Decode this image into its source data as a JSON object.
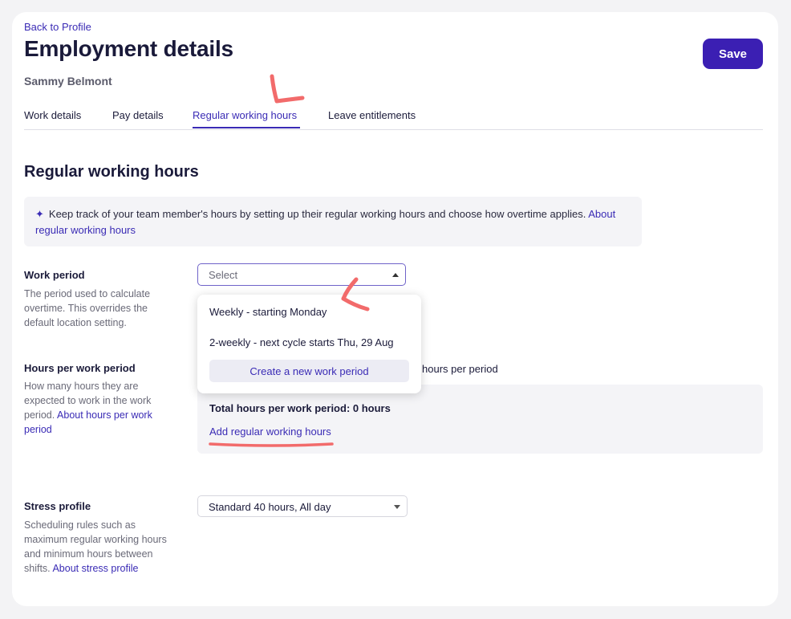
{
  "header": {
    "back_link": "Back to Profile",
    "title": "Employment details",
    "employee_name": "Sammy Belmont",
    "save_label": "Save"
  },
  "tabs": [
    {
      "label": "Work details"
    },
    {
      "label": "Pay details"
    },
    {
      "label": "Regular working hours",
      "active": true
    },
    {
      "label": "Leave entitlements"
    }
  ],
  "section": {
    "title": "Regular working hours",
    "info_text": "Keep track of your team member's hours by setting up their regular working hours and choose how overtime applies.",
    "info_link": "About regular working hours",
    "info_icon": "sparkle-icon"
  },
  "work_period": {
    "label": "Work period",
    "help": "The period used to calculate overtime. This overrides the default location setting.",
    "placeholder": "Select",
    "options": [
      "Weekly - starting Monday",
      "2-weekly - next cycle starts Thu, 29 Aug"
    ],
    "create_label": "Create a new work period"
  },
  "hours_per_period": {
    "label": "Hours per work period",
    "help": "How many hours they are expected to work in the work period.",
    "help_link": "About hours per work period",
    "tail_text": "hours per period",
    "total_text": "Total hours per work period: 0 hours",
    "add_link": "Add regular working hours"
  },
  "stress_profile": {
    "label": "Stress profile",
    "help": "Scheduling rules such as maximum regular working hours and minimum hours between shifts.",
    "help_link": "About stress profile",
    "value": "Standard 40 hours, All day"
  },
  "colors": {
    "accent": "#3b1fb3",
    "annotation": "#f26b6b",
    "panel": "#f4f4f7"
  }
}
